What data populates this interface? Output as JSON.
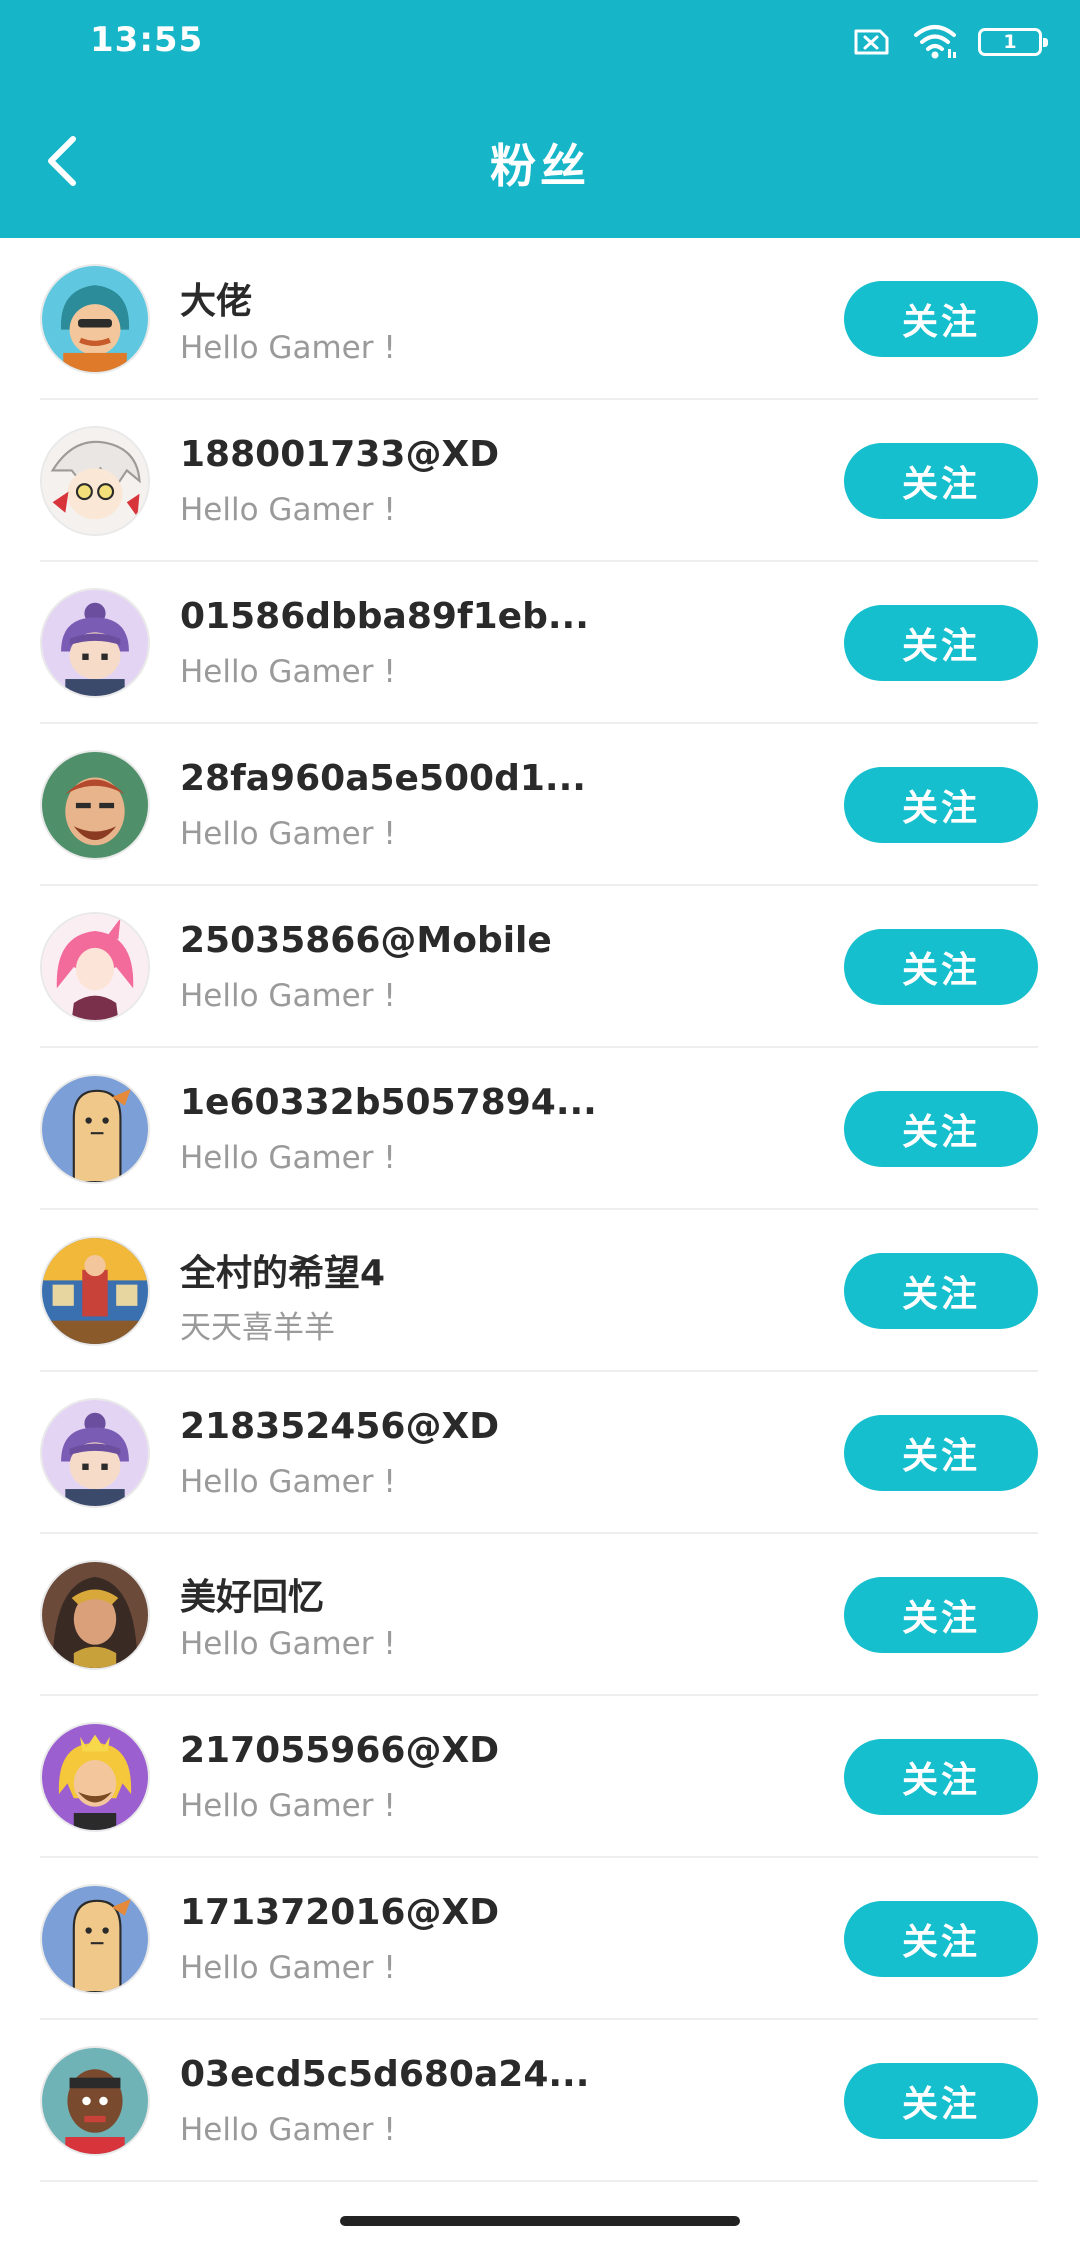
{
  "status_bar": {
    "time": "13:55",
    "battery_level": "1",
    "icons": [
      "sim-error-icon",
      "wifi-icon",
      "battery-icon"
    ]
  },
  "header": {
    "title": "粉丝",
    "back_icon": "chevron-left-icon",
    "background_color": "#16b6c8"
  },
  "fans": [
    {
      "name": "大佬",
      "bio": "Hello Gamer !",
      "follow_label": "关注",
      "avatar": "cartoon-hero-teal"
    },
    {
      "name": "188001733@XD",
      "bio": "Hello Gamer !",
      "follow_label": "关注",
      "avatar": "anime-red-white"
    },
    {
      "name": "01586dbba89f1eb...",
      "bio": "Hello Gamer !",
      "follow_label": "关注",
      "avatar": "purple-hair-character"
    },
    {
      "name": "28fa960a5e500d1...",
      "bio": "Hello Gamer !",
      "follow_label": "关注",
      "avatar": "bearded-warrior-green"
    },
    {
      "name": "25035866@Mobile",
      "bio": "Hello Gamer !",
      "follow_label": "关注",
      "avatar": "pink-hair-anime"
    },
    {
      "name": "1e60332b5057894...",
      "bio": "Hello Gamer !",
      "follow_label": "关注",
      "avatar": "potato-character-blue"
    },
    {
      "name": "全村的希望4",
      "bio": "天天喜羊羊",
      "follow_label": "关注",
      "avatar": "game-scene-colorful"
    },
    {
      "name": "218352456@XD",
      "bio": "Hello Gamer !",
      "follow_label": "关注",
      "avatar": "purple-hair-character"
    },
    {
      "name": "美好回忆",
      "bio": "Hello Gamer !",
      "follow_label": "关注",
      "avatar": "warrior-woman"
    },
    {
      "name": "217055966@XD",
      "bio": "Hello Gamer !",
      "follow_label": "关注",
      "avatar": "blonde-king-purple"
    },
    {
      "name": "171372016@XD",
      "bio": "Hello Gamer !",
      "follow_label": "关注",
      "avatar": "potato-character-blue"
    },
    {
      "name": "03ecd5c5d680a24...",
      "bio": "Hello Gamer !",
      "follow_label": "关注",
      "avatar": "basketball-player-red"
    }
  ],
  "colors": {
    "accent": "#16bfcd",
    "name_text": "#2a2a2a",
    "bio_text": "#9a9a9a",
    "divider": "#eeeeee"
  }
}
